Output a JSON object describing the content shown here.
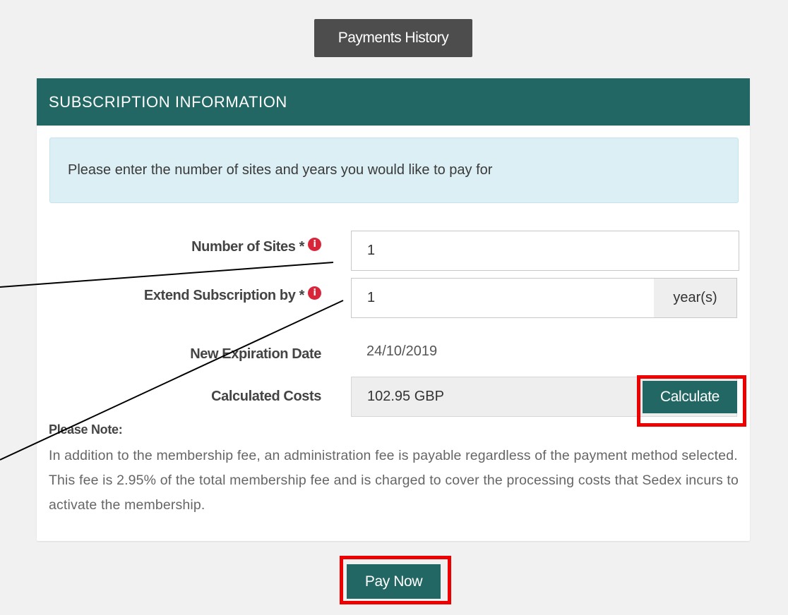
{
  "header": {
    "history_label": "Payments History"
  },
  "subscription": {
    "panel_title": "SUBSCRIPTION INFORMATION",
    "info_message": "Please enter the number of sites and years you would like to pay for",
    "fields": {
      "sites_label": "Number of Sites *",
      "sites_value": "1",
      "extend_label": "Extend Subscription by *",
      "extend_value": "1",
      "extend_unit": "year(s)",
      "expiration_label": "New Expiration Date",
      "expiration_value": "24/10/2019",
      "costs_label": "Calculated Costs",
      "costs_value": "102.95 GBP",
      "calculate_label": "Calculate"
    },
    "note": {
      "title": "Please Note:",
      "body": "In addition to the membership fee, an administration fee is payable regardless of the payment method selected. This fee is 2.95% of the total membership fee and is charged to cover the processing costs that Sedex incurs to activate the membership."
    }
  },
  "footer": {
    "pay_label": "Pay Now"
  },
  "colors": {
    "page_bg": "#f1f1f1",
    "brand_teal": "#226764",
    "history_button": "#4d4d4d",
    "info_box_bg": "#dbeff5",
    "required_icon": "#d9253a",
    "highlight_box": "#ee0000"
  },
  "icons": {
    "required_info": "info-circle-icon"
  }
}
